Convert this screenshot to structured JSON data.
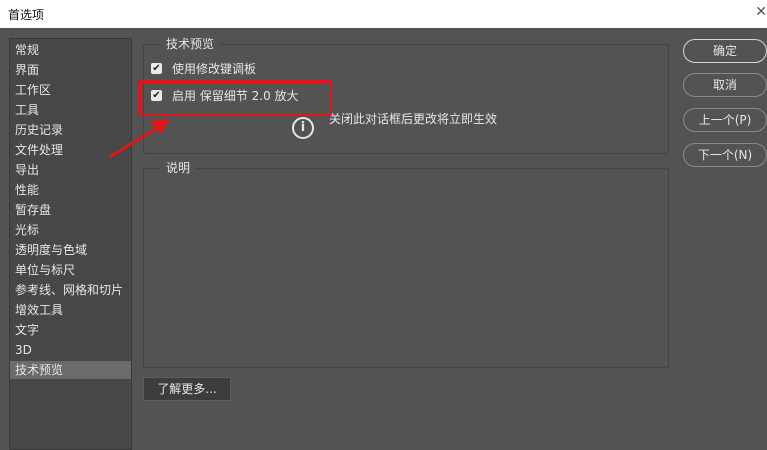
{
  "window": {
    "title": "首选项",
    "close_glyph": "✕"
  },
  "sidebar": {
    "items": [
      {
        "label": "常规"
      },
      {
        "label": "界面"
      },
      {
        "label": "工作区"
      },
      {
        "label": "工具"
      },
      {
        "label": "历史记录"
      },
      {
        "label": "文件处理"
      },
      {
        "label": "导出"
      },
      {
        "label": "性能"
      },
      {
        "label": "暂存盘"
      },
      {
        "label": "光标"
      },
      {
        "label": "透明度与色域"
      },
      {
        "label": "单位与标尺"
      },
      {
        "label": "参考线、网格和切片"
      },
      {
        "label": "增效工具"
      },
      {
        "label": "文字"
      },
      {
        "label": "3D"
      },
      {
        "label": "技术预览",
        "selected": true
      }
    ]
  },
  "tech_preview": {
    "legend": "技术预览",
    "options": [
      {
        "label": "使用修改键调板",
        "checked": true
      },
      {
        "label": "启用 保留细节 2.0 放大",
        "checked": true
      }
    ],
    "notice": "关闭此对话框后更改将立即生效",
    "notice_icon": "info-icon"
  },
  "description": {
    "legend": "说明"
  },
  "learn_more": {
    "label": "了解更多..."
  },
  "buttons": {
    "ok": "确定",
    "cancel": "取消",
    "prev": "上一个(P)",
    "next": "下一个(N)"
  },
  "annotation": {
    "color": "#e0151b"
  }
}
